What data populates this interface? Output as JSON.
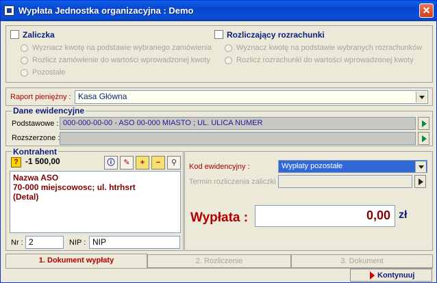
{
  "window": {
    "title": "Wypłata Jednostka organizacyjna : Demo",
    "close_glyph": "✕"
  },
  "zaliczka": {
    "label": "Zaliczka",
    "options": [
      "Wyznacz kwotę na podstawie wybranego zamówienia",
      "Rozlicz zamówienie do wartości wprowadzonej kwoty",
      "Pozostałe"
    ]
  },
  "rozrachunki": {
    "label": "Rozliczający rozrachunki",
    "options": [
      "Wyznacz kwotę na podstawie wybranych rozrachunków",
      "Rozlicz rozrachunki do wartości wprowadzonej kwoty"
    ]
  },
  "raport": {
    "label": "Raport pieniężny :",
    "value": "Kasa Główna"
  },
  "dane": {
    "legend": "Dane ewidencyjne",
    "podstawowe_label": "Podstawowe :",
    "podstawowe_value": "000-000-00-00 - ASO 00-000 MIASTO ; UL. ULICA NUMER",
    "rozszerzone_label": "Rozszerzone :",
    "rozszerzone_value": ""
  },
  "kontrahent": {
    "legend": "Kontrahent",
    "help_glyph": "?",
    "balance": "-1 500,00",
    "lines": [
      "Nazwa ASO",
      "70-000 miejscowosc; ul. htrhsrt",
      "(Detal)"
    ],
    "nr_label": "Nr :",
    "nr_value": "2",
    "nip_label": "NIP :",
    "nip_value": "NIP"
  },
  "kod": {
    "label": "Kod ewidencyjny :",
    "value": "Wypłaty pozostałe"
  },
  "termin": {
    "label": "Termin rozliczenia zaliczki :",
    "value": ""
  },
  "wyplata": {
    "label": "Wypłata :",
    "value": "0,00",
    "currency": "zł"
  },
  "tabs": [
    "1. Dokument wypłaty",
    "2. Rozliczenie",
    "3. Dokument"
  ],
  "continue_label": "Kontynuuj",
  "colors": {
    "accent_red": "#b00000",
    "navy": "#0a1e80",
    "title_blue": "#0846cc"
  }
}
